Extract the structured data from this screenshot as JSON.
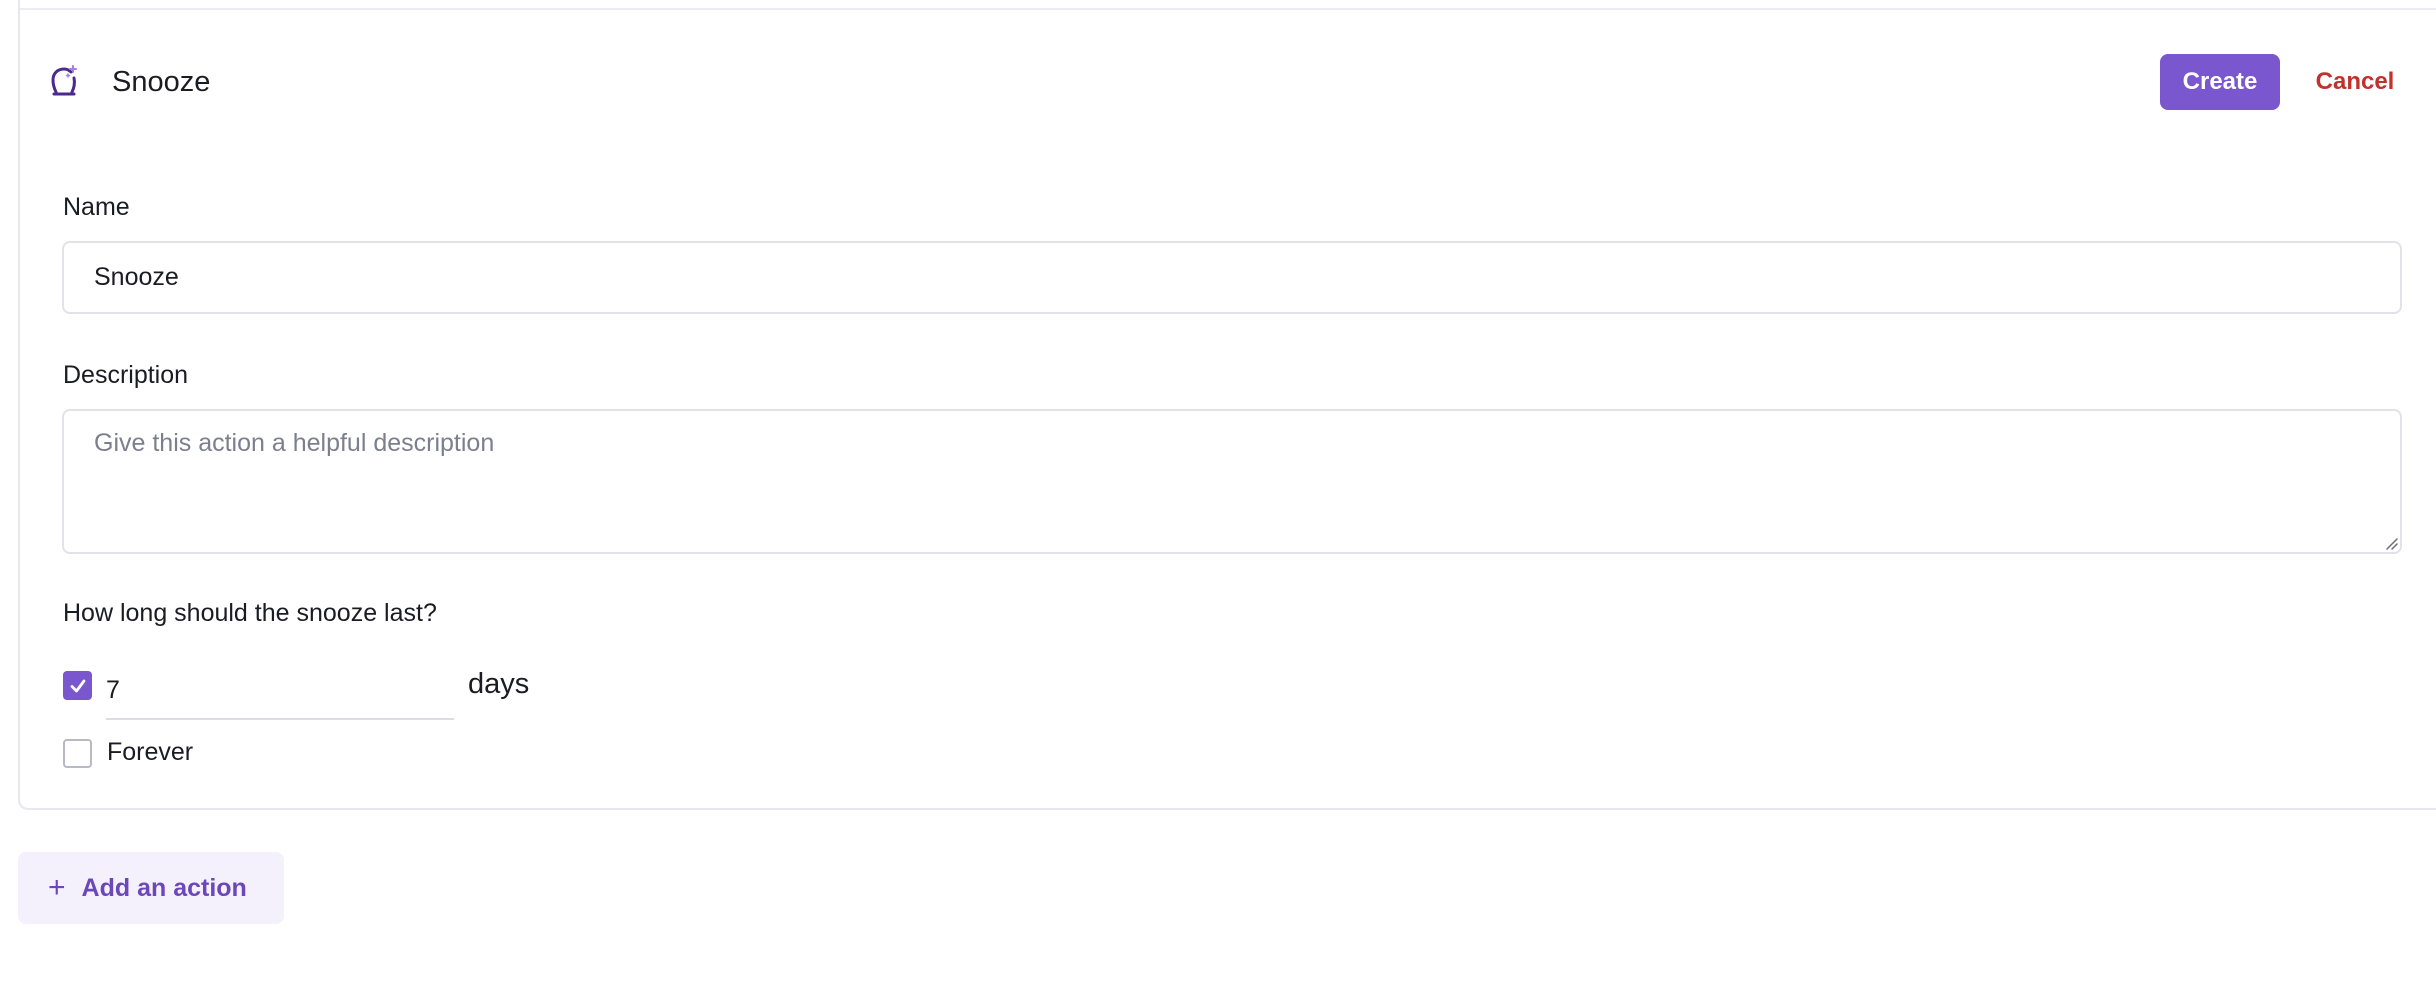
{
  "action": {
    "title": "Snooze",
    "icon": "snooze-bell-icon",
    "create_label": "Create",
    "cancel_label": "Cancel"
  },
  "form": {
    "name_label": "Name",
    "name_value": "Snooze",
    "description_label": "Description",
    "description_placeholder": "Give this action a helpful description",
    "description_value": "",
    "duration_question": "How long should the snooze last?",
    "duration": {
      "checked": true,
      "value": "7",
      "unit": "days"
    },
    "forever": {
      "checked": false,
      "label": "Forever"
    }
  },
  "add_action": {
    "label": "Add an action",
    "icon": "plus-icon"
  },
  "colors": {
    "accent": "#7a57cf",
    "cancel": "#c0322e",
    "add_action_bg": "#f4f0fc",
    "add_action_text": "#6c47b8"
  }
}
